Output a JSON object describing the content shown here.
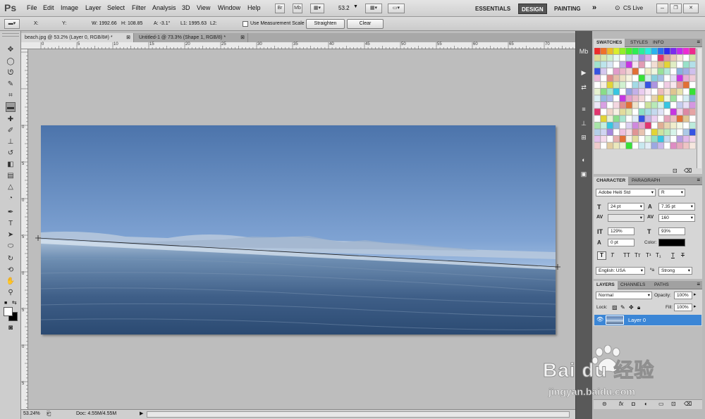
{
  "menubar": {
    "logo": "Ps",
    "items": [
      "File",
      "Edit",
      "Image",
      "Layer",
      "Select",
      "Filter",
      "Analysis",
      "3D",
      "View",
      "Window",
      "Help"
    ],
    "zoom_value": "53.2",
    "workspaces": [
      "ESSENTIALS",
      "DESIGN",
      "PAINTING"
    ],
    "active_workspace": "DESIGN",
    "more": "»",
    "cs_live": "CS Live"
  },
  "options": {
    "x_label": "X:",
    "y_label": "Y:",
    "w": "W: 1992.66",
    "h": "H: 108.85",
    "a": "A: -3.1°",
    "l1": "L1: 1995.63",
    "l2": "L2:",
    "measurement_scale": "Use Measurement Scale",
    "straighten": "Straighten",
    "clear": "Clear"
  },
  "tabs": [
    {
      "label": "beach.jpg @ 53.2% (Layer 0, RGB/8#) *",
      "active": true
    },
    {
      "label": "Untitled-1 @ 73.3% (Shape 1, RGB/8) *",
      "active": false
    }
  ],
  "ruler_h": [
    "0",
    "5",
    "10",
    "15",
    "20",
    "25",
    "30",
    "35",
    "40",
    "45",
    "50",
    "55",
    "60",
    "65",
    "70"
  ],
  "ruler_v": [
    "0",
    "5",
    "0",
    "5",
    "0",
    "5",
    "0",
    "5",
    "0"
  ],
  "status": {
    "zoom": "53.24%",
    "doc": "Doc: 4.55M/4.55M"
  },
  "swatches": {
    "tabs": [
      "SWATCHES",
      "STYLES",
      "INFO"
    ]
  },
  "character": {
    "tabs": [
      "CHARACTER",
      "PARAGRAPH"
    ],
    "font_family": "Adobe Heiti Std",
    "font_style": "R",
    "font_size": "24 pt",
    "leading": "7.35 pt",
    "kerning": "",
    "tracking": "160",
    "vertical_scale": "129%",
    "horizontal_scale": "93%",
    "baseline_shift": "0 pt",
    "color_label": "Color:",
    "text_color": "#000000",
    "language": "English: USA",
    "antialias_icon": "ªa",
    "antialias": "Strong"
  },
  "layers": {
    "tabs": [
      "LAYERS",
      "CHANNELS",
      "PATHS"
    ],
    "blend_mode": "Normal",
    "opacity_label": "Opacity:",
    "opacity": "100%",
    "lock_label": "Lock:",
    "fill_label": "Fill:",
    "fill": "100%",
    "layer_name": "Layer 0"
  },
  "colors": {
    "accent": "#3b86d6",
    "workspace_active": "#555555"
  },
  "watermark": {
    "brand": "Bai du 经验",
    "url": "jingyan.baidu.com"
  }
}
